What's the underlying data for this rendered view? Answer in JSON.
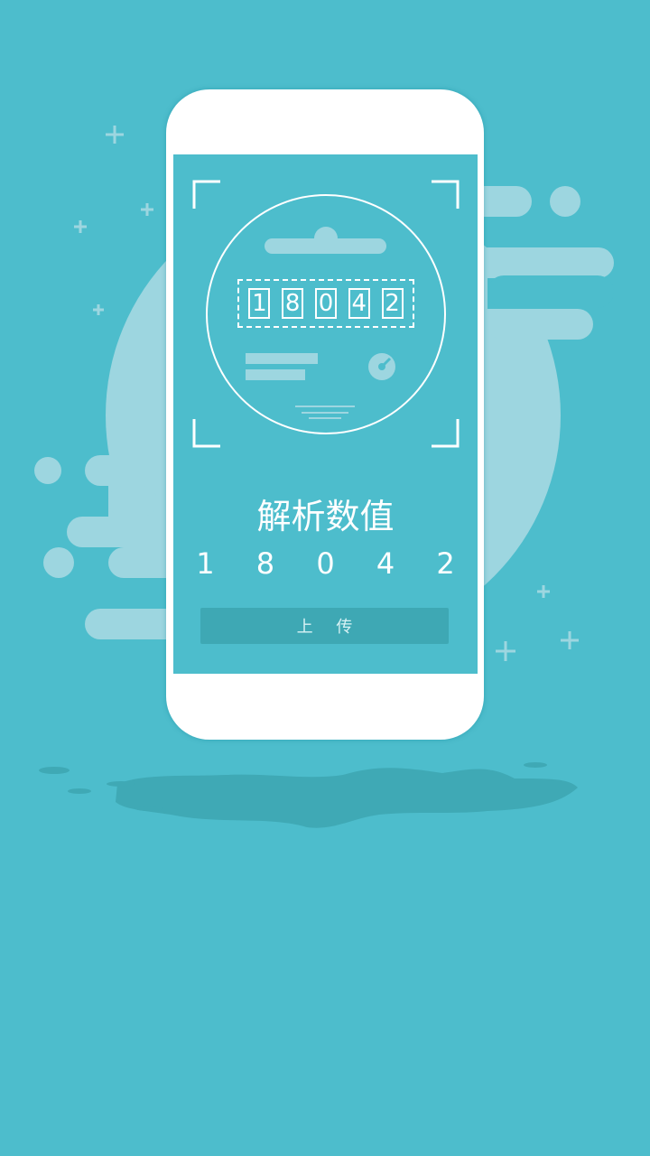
{
  "meter": {
    "digits": [
      "1",
      "8",
      "0",
      "4",
      "2"
    ],
    "scan_frame": "corner-brackets"
  },
  "result": {
    "title": "解析数值",
    "value": "1 8 0 4 2"
  },
  "actions": {
    "upload_label": "上 传"
  },
  "colors": {
    "background": "#4dbdcc",
    "decor": "#9dd6e0",
    "shadow": "#3fa9b5",
    "button": "#3ea8b4"
  }
}
